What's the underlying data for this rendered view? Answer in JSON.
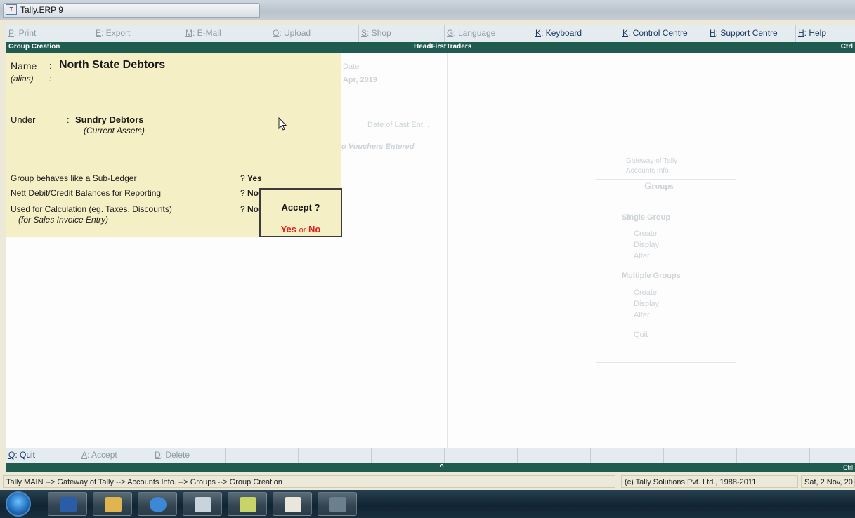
{
  "window": {
    "title": "Tally.ERP 9",
    "icon": "tally-app-icon"
  },
  "toolbar": {
    "buttons": [
      {
        "key": "P",
        "label": ": Print",
        "active": false
      },
      {
        "key": "E",
        "label": ": Export",
        "active": false
      },
      {
        "key": "M",
        "label": ": E-Mail",
        "active": false
      },
      {
        "key": "O",
        "label": ": Upload",
        "active": false
      },
      {
        "key": "S",
        "label": ": Shop",
        "active": false
      },
      {
        "key": "G",
        "label": ": Language",
        "active": false
      },
      {
        "key": "K",
        "label": ": Keyboard",
        "active": true
      },
      {
        "key": "K",
        "label": ": Control Centre",
        "active": true
      },
      {
        "key": "H",
        "label": ": Support Centre",
        "active": true
      },
      {
        "key": "H",
        "label": ": Help",
        "active": true
      }
    ]
  },
  "header": {
    "screen": "Group Creation",
    "company": "HeadFirstTraders",
    "ctrl": "Ctrl"
  },
  "background": {
    "date_label": "Date",
    "date_value": "Apr, 2019",
    "last_entry": "Date of Last Ent...",
    "vouchers": "o Vouchers Entered",
    "gateway_title": "Gateway of Tally",
    "gateway_sub": "Accounts Info.",
    "panel_title": "Groups",
    "single_group": "Single Group",
    "single_items": [
      "Create",
      "Display",
      "Alter"
    ],
    "multiple_groups": "Multiple Groups",
    "multiple_items": [
      "Create",
      "Display",
      "Alter"
    ],
    "quit": "Quit"
  },
  "form": {
    "name_label": "Name",
    "name_value": "North State Debtors",
    "alias_label": "(alias)",
    "under_label": "Under",
    "under_value": "Sundry Debtors",
    "under_parent": "(Current Assets)",
    "q1_label": "Group behaves like a Sub-Ledger",
    "q1_value": "Yes",
    "q2_label": "Nett Debit/Credit Balances for Reporting",
    "q2_value": "No",
    "q3_label": "Used for Calculation (eg. Taxes, Discounts)",
    "q3_value": "No",
    "q3_sub": "(for Sales Invoice Entry)",
    "sep": ":",
    "q": "?"
  },
  "accept_dialog": {
    "question": "Accept ?",
    "yes": "Yes",
    "or": "or",
    "no": "No"
  },
  "bottom_bar": {
    "buttons": [
      {
        "key": "Q",
        "label": ": Quit",
        "active": true
      },
      {
        "key": "A",
        "label": ": Accept",
        "active": false
      },
      {
        "key": "D",
        "label": ": Delete",
        "active": false
      }
    ],
    "ctrl": "Ctrl",
    "caret": "^"
  },
  "status_bar": {
    "breadcrumb": "Tally MAIN --> Gateway of Tally --> Accounts Info. --> Groups --> Group Creation",
    "copyright": "(c) Tally Solutions Pvt. Ltd., 1988-2011",
    "date": "Sat, 2 Nov, 20"
  },
  "taskbar": {
    "apps": [
      "start-orb",
      "word",
      "file-explorer",
      "internet-explorer",
      "calculator",
      "notes",
      "tally-erp",
      "media"
    ]
  }
}
